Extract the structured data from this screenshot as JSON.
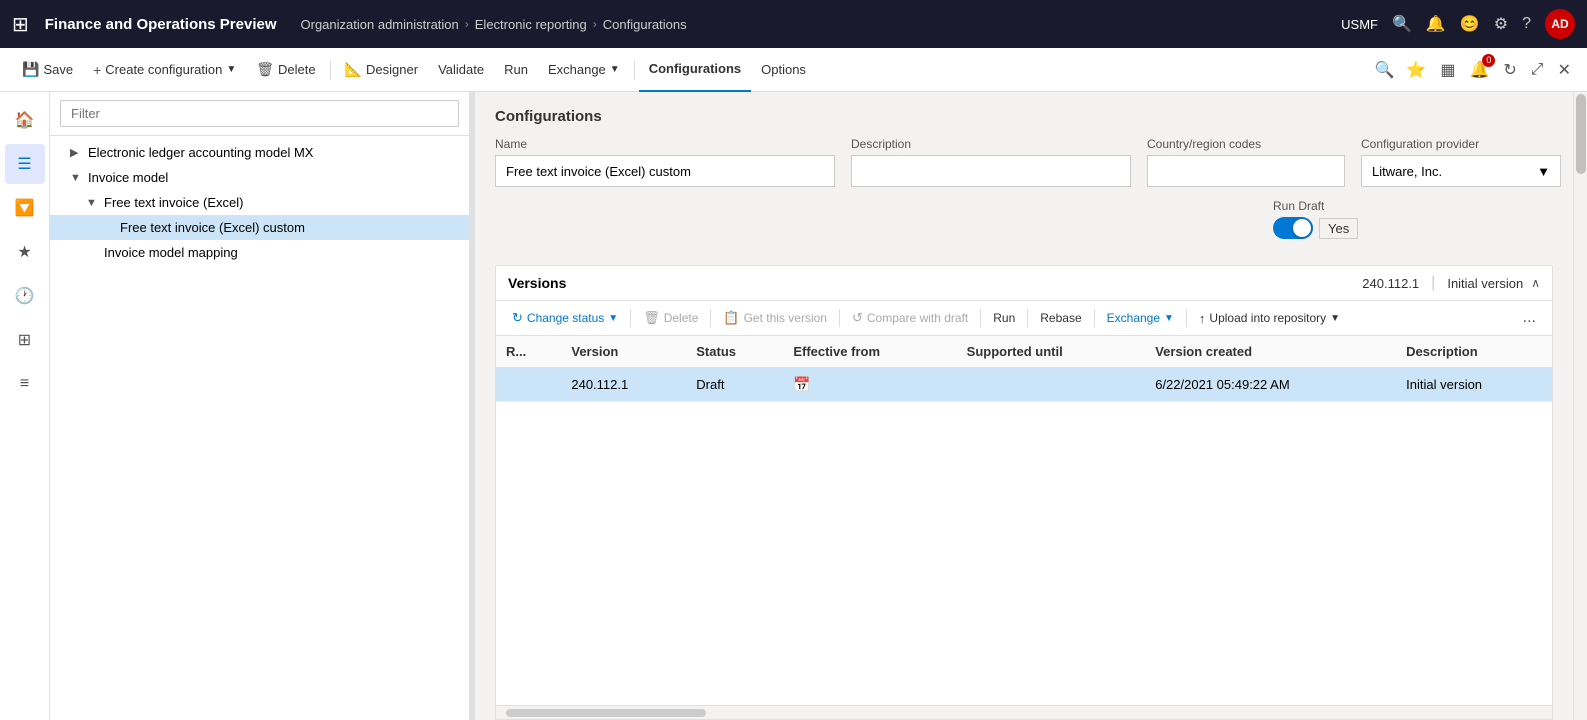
{
  "app": {
    "title": "Finance and Operations Preview",
    "env": "USMF"
  },
  "breadcrumb": {
    "items": [
      "Organization administration",
      "Electronic reporting",
      "Configurations"
    ]
  },
  "toolbar": {
    "save": "Save",
    "create_config": "Create configuration",
    "delete": "Delete",
    "designer": "Designer",
    "validate": "Validate",
    "run": "Run",
    "exchange": "Exchange",
    "configurations": "Configurations",
    "options": "Options"
  },
  "sidebar": {
    "filter_placeholder": "Filter"
  },
  "tree": {
    "items": [
      {
        "id": "electronic-ledger",
        "label": "Electronic ledger accounting model MX",
        "indent": 1,
        "arrow": "▶",
        "selected": false
      },
      {
        "id": "invoice-model",
        "label": "Invoice model",
        "indent": 1,
        "arrow": "▼",
        "selected": false
      },
      {
        "id": "free-text-invoice-excel",
        "label": "Free text invoice (Excel)",
        "indent": 2,
        "arrow": "▼",
        "selected": false
      },
      {
        "id": "free-text-invoice-excel-custom",
        "label": "Free text invoice (Excel) custom",
        "indent": 3,
        "arrow": "",
        "selected": true
      },
      {
        "id": "invoice-model-mapping",
        "label": "Invoice model mapping",
        "indent": 2,
        "arrow": "",
        "selected": false
      }
    ]
  },
  "form": {
    "section_title": "Configurations",
    "name_label": "Name",
    "name_value": "Free text invoice (Excel) custom",
    "description_label": "Description",
    "description_value": "",
    "country_label": "Country/region codes",
    "country_value": "",
    "provider_label": "Configuration provider",
    "provider_value": "Litware, Inc.",
    "run_draft_label": "Run Draft",
    "run_draft_toggle": "Yes"
  },
  "versions": {
    "section_title": "Versions",
    "meta": "240.112.1",
    "meta2": "Initial version",
    "toolbar": {
      "change_status": "Change status",
      "delete": "Delete",
      "get_this_version": "Get this version",
      "compare_with_draft": "Compare with draft",
      "run": "Run",
      "rebase": "Rebase",
      "exchange": "Exchange",
      "upload_into_repository": "Upload into repository",
      "more": "..."
    },
    "table": {
      "columns": [
        "R...",
        "Version",
        "Status",
        "Effective from",
        "Supported until",
        "Version created",
        "Description"
      ],
      "rows": [
        {
          "r": "",
          "version": "240.112.1",
          "status": "Draft",
          "effective_from": "",
          "supported_until": "",
          "version_created": "6/22/2021 05:49:22 AM",
          "description": "Initial version",
          "selected": true
        }
      ]
    }
  }
}
